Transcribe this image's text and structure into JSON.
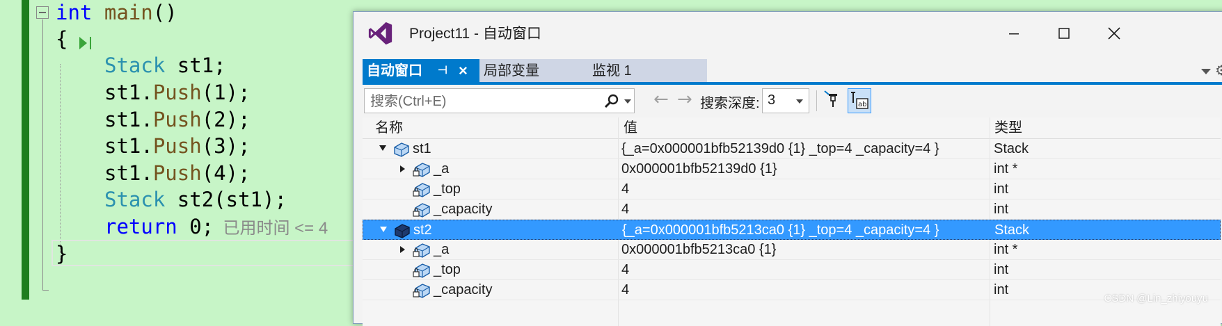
{
  "editor": {
    "lines": [
      {
        "parts": [
          {
            "t": "int",
            "c": "kw"
          },
          {
            "t": " "
          },
          {
            "t": "main",
            "c": "fn"
          },
          {
            "t": "()"
          }
        ]
      },
      {
        "parts": [
          {
            "t": "{"
          }
        ]
      },
      {
        "parts": [
          {
            "t": "Stack",
            "c": "type"
          },
          {
            "t": " st1;"
          }
        ]
      },
      {
        "parts": [
          {
            "t": "st1."
          },
          {
            "t": "Push",
            "c": "fn"
          },
          {
            "t": "(1);"
          }
        ]
      },
      {
        "parts": [
          {
            "t": "st1."
          },
          {
            "t": "Push",
            "c": "fn"
          },
          {
            "t": "(2);"
          }
        ]
      },
      {
        "parts": [
          {
            "t": "st1."
          },
          {
            "t": "Push",
            "c": "fn"
          },
          {
            "t": "(3);"
          }
        ]
      },
      {
        "parts": [
          {
            "t": "st1."
          },
          {
            "t": "Push",
            "c": "fn"
          },
          {
            "t": "(4);"
          }
        ]
      },
      {
        "parts": [
          {
            "t": "Stack",
            "c": "type"
          },
          {
            "t": " st2(st1);"
          }
        ]
      },
      {
        "parts": [
          {
            "t": "return",
            "c": "kw"
          },
          {
            "t": " 0;"
          }
        ]
      },
      {
        "parts": [
          {
            "t": "}"
          }
        ]
      }
    ],
    "elapsed_hint": "已用时间 <= 4"
  },
  "window": {
    "title": "Project11 - 自动窗口",
    "minimize_icon": "minimize-icon",
    "maximize_icon": "maximize-icon",
    "close_icon": "close-icon"
  },
  "tabs": [
    {
      "label": "自动窗口",
      "active": true
    },
    {
      "label": "局部变量",
      "active": false
    },
    {
      "label": "监视 1",
      "active": false
    }
  ],
  "toolbar": {
    "search_placeholder": "搜索(Ctrl+E)",
    "depth_label": "搜索深度:",
    "depth_value": "3"
  },
  "grid": {
    "columns": [
      "名称",
      "值",
      "类型"
    ],
    "rows": [
      {
        "name": "st1",
        "value": "{_a=0x000001bfb52139d0 {1} _top=4 _capacity=4 }",
        "type": "Stack",
        "level": 0,
        "expander": "open",
        "icon": "object-icon",
        "selected": false
      },
      {
        "name": "_a",
        "value": "0x000001bfb52139d0 {1}",
        "type": "int *",
        "level": 1,
        "expander": "closed",
        "icon": "private-field-icon",
        "selected": false
      },
      {
        "name": "_top",
        "value": "4",
        "type": "int",
        "level": 1,
        "expander": "none",
        "icon": "private-field-icon",
        "selected": false
      },
      {
        "name": "_capacity",
        "value": "4",
        "type": "int",
        "level": 1,
        "expander": "none",
        "icon": "private-field-icon",
        "selected": false
      },
      {
        "name": "st2",
        "value": "{_a=0x000001bfb5213ca0 {1} _top=4 _capacity=4 }",
        "type": "Stack",
        "level": 0,
        "expander": "open",
        "icon": "object-icon",
        "selected": true
      },
      {
        "name": "_a",
        "value": "0x000001bfb5213ca0 {1}",
        "type": "int *",
        "level": 1,
        "expander": "closed",
        "icon": "private-field-icon",
        "selected": false
      },
      {
        "name": "_top",
        "value": "4",
        "type": "int",
        "level": 1,
        "expander": "none",
        "icon": "private-field-icon",
        "selected": false
      },
      {
        "name": "_capacity",
        "value": "4",
        "type": "int",
        "level": 1,
        "expander": "none",
        "icon": "private-field-icon",
        "selected": false
      }
    ]
  },
  "watermark": "CSDN @Lin_zhiyouyu",
  "colors": {
    "editor_bg": "#c7f5c7",
    "accent": "#007acc",
    "selection": "#3399ff",
    "vs_purple": "#68217a"
  }
}
